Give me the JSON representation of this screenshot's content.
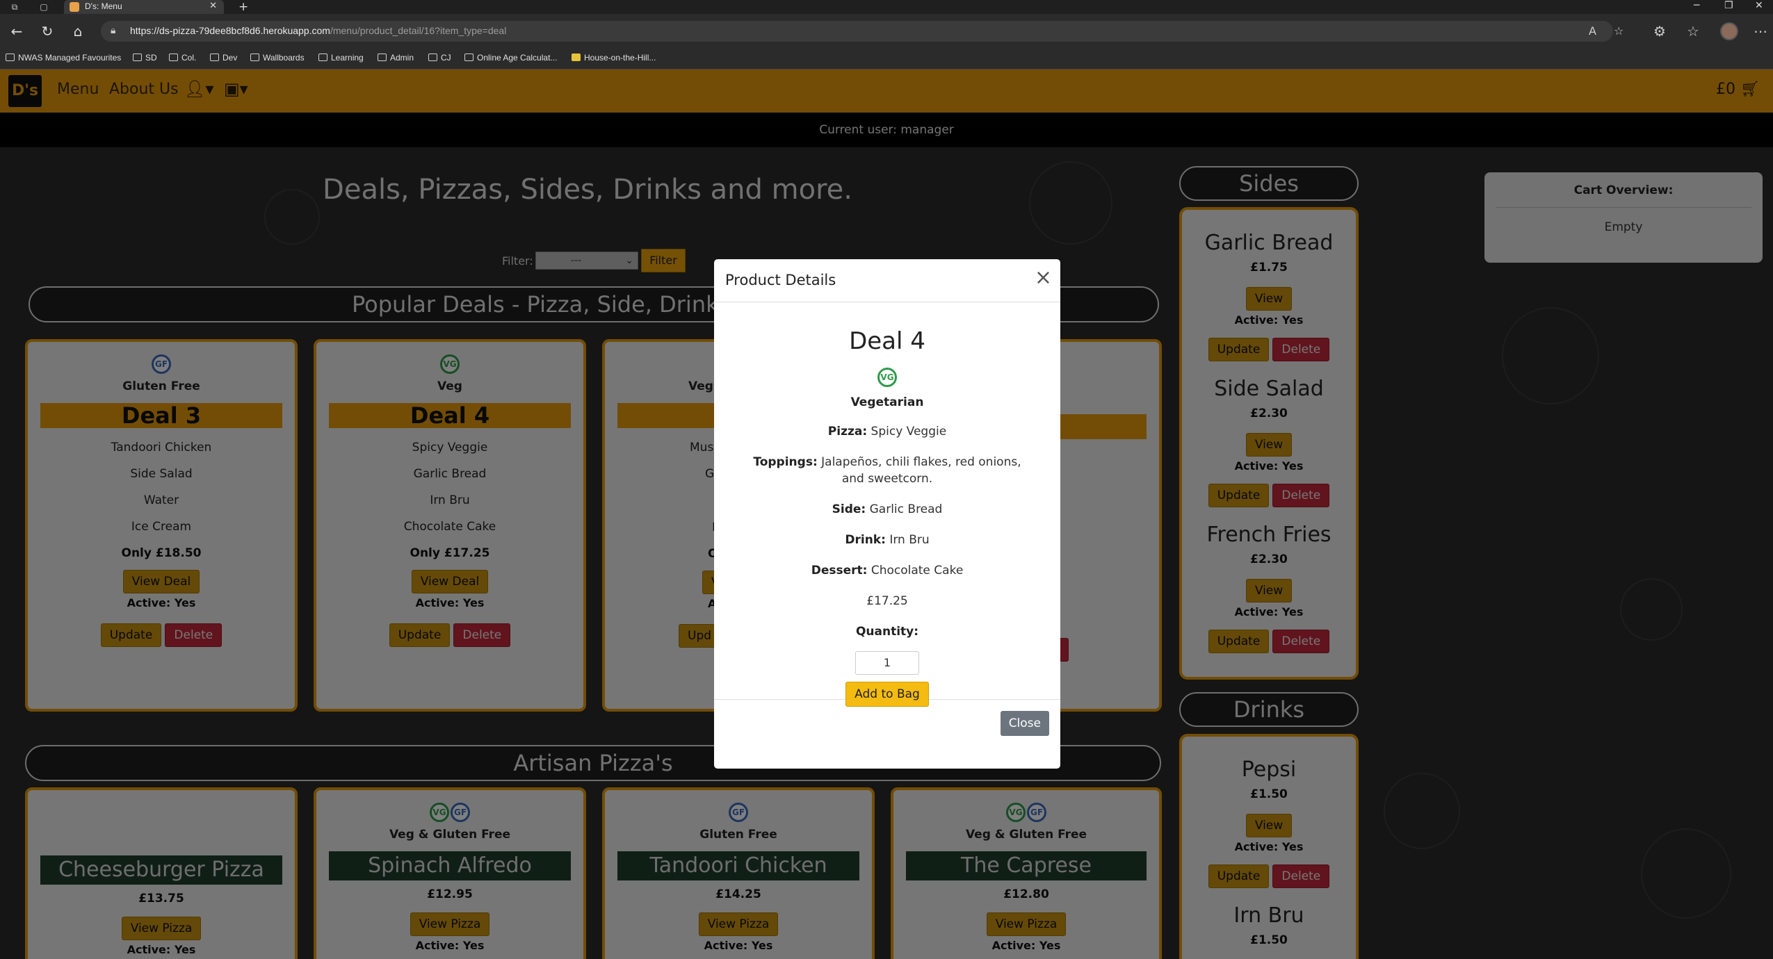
{
  "browser": {
    "tab_title": "D's: Menu",
    "url_rest": "/menu/product_detail/16?item_type=deal",
    "url_host": "https://ds-pizza-79dee8bcf8d6.herokuapp.com",
    "bookmarks": [
      "NWAS Managed Favourites",
      "SD",
      "Col.",
      "Dev",
      "Wallboards",
      "Learning",
      "Admin",
      "CJ",
      "Online Age Calculat...",
      "House-on-the-Hill..."
    ]
  },
  "nav": {
    "logo": "D's",
    "menu": "Menu",
    "about": "About Us",
    "cart_total": "£0",
    "current_user": "Current user: manager"
  },
  "page": {
    "heading": "Deals, Pizzas, Sides, Drinks and more.",
    "filter_label": "Filter:",
    "filter_value": "---",
    "filter_button": "Filter",
    "deals_section": "Popular Deals - Pizza, Side, Drink & Dessert",
    "pizzas_section": "Artisan Pizza's"
  },
  "deals": [
    {
      "badge": "GF",
      "diet": "Gluten Free",
      "title": "Deal 3",
      "pizza": "Tandoori Chicken",
      "side": "Side Salad",
      "drink": "Water",
      "dessert": "Ice Cream",
      "price": "Only £18.50",
      "view": "View Deal",
      "active": "Active: Yes",
      "update": "Update",
      "delete": "Delete"
    },
    {
      "badge": "VG",
      "diet": "Veg",
      "title": "Deal 4",
      "pizza": "Spicy Veggie",
      "side": "Garlic Bread",
      "drink": "Irn Bru",
      "dessert": "Chocolate Cake",
      "price": "Only £17.25",
      "view": "View Deal",
      "active": "Active: Yes",
      "update": "Update",
      "delete": "Delete"
    },
    {
      "badge": "VG",
      "diet": "Veg",
      "title": "D",
      "pizza": "Mus",
      "side": "Ga",
      "drink": "",
      "dessert": "I",
      "price": "O",
      "view": "V",
      "active": "A",
      "update": "Upd",
      "delete": ""
    },
    {
      "badge": "",
      "diet": "",
      "title": "",
      "pizza": "",
      "side": "",
      "drink": "",
      "dessert": "",
      "price": "",
      "view": "",
      "active": "",
      "update": "",
      "delete": "ete"
    }
  ],
  "pizzas": [
    {
      "badges": [],
      "diet": "",
      "title": "Cheeseburger Pizza",
      "price": "£13.75",
      "view": "View Pizza",
      "active": "Active: Yes"
    },
    {
      "badges": [
        "VG",
        "GF"
      ],
      "diet": "Veg & Gluten Free",
      "title": "Spinach Alfredo",
      "price": "£12.95",
      "view": "View Pizza",
      "active": "Active: Yes"
    },
    {
      "badges": [
        "GF"
      ],
      "diet": "Gluten Free",
      "title": "Tandoori Chicken",
      "price": "£14.25",
      "view": "View Pizza",
      "active": "Active: Yes"
    },
    {
      "badges": [
        "VG",
        "GF"
      ],
      "diet": "Veg & Gluten Free",
      "title": "The Caprese",
      "price": "£12.80",
      "view": "View Pizza",
      "active": "Active: Yes"
    }
  ],
  "sides": {
    "header": "Sides",
    "items": [
      {
        "name": "Garlic Bread",
        "price": "£1.75",
        "view": "View",
        "active": "Active: Yes",
        "update": "Update",
        "delete": "Delete"
      },
      {
        "name": "Side Salad",
        "price": "£2.30",
        "view": "View",
        "active": "Active: Yes",
        "update": "Update",
        "delete": "Delete"
      },
      {
        "name": "French Fries",
        "price": "£2.30",
        "view": "View",
        "active": "Active: Yes",
        "update": "Update",
        "delete": "Delete"
      }
    ]
  },
  "drinks": {
    "header": "Drinks",
    "items": [
      {
        "name": "Pepsi",
        "price": "£1.50",
        "view": "View",
        "active": "Active: Yes",
        "update": "Update",
        "delete": "Delete"
      },
      {
        "name": "Irn Bru",
        "price": "£1.50"
      }
    ]
  },
  "cart_overview": {
    "title": "Cart Overview:",
    "state": "Empty"
  },
  "modal": {
    "title": "Product Details",
    "deal_title": "Deal 4",
    "badge": "VG",
    "diet": "Vegetarian",
    "pizza_label": "Pizza:",
    "pizza_value": "Spicy Veggie",
    "toppings_label": "Toppings:",
    "toppings_value": "Jalapeños, chili flakes, red onions, and sweetcorn.",
    "side_label": "Side:",
    "side_value": "Garlic Bread",
    "drink_label": "Drink:",
    "drink_value": "Irn Bru",
    "dessert_label": "Dessert:",
    "dessert_value": "Chocolate Cake",
    "price": "£17.25",
    "quantity_label": "Quantity:",
    "quantity_value": "1",
    "add_button": "Add to Bag",
    "close_button": "Close"
  },
  "colors": {
    "brand_orange": "#e79b0c",
    "delete_red": "#c3283a",
    "pizza_green": "#213f2c",
    "close_grey": "#6c757d"
  }
}
